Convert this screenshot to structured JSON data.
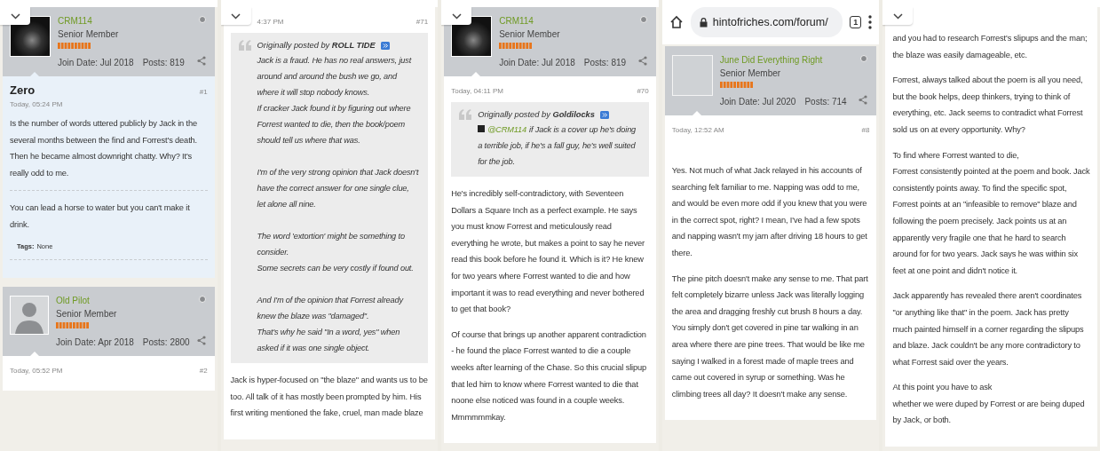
{
  "panels": [
    {
      "collapse_button": true,
      "posts": [
        {
          "profile": {
            "name": "CRM114",
            "title": "Senior Member",
            "join": "Join Date: Jul 2018",
            "posts": "Posts: 819",
            "avatar": {
              "kind": "photo"
            }
          },
          "body": {
            "highlighted": true,
            "title": "Zero",
            "date": "Today, 05:24 PM",
            "number": "#1",
            "blocks": [
              {
                "kind": "text",
                "text": "Is the number of words uttered publicly by Jack in the several months between the find and Forrest's death. Then he became almost downright chatty. Why? It's really odd to me."
              },
              {
                "kind": "signature",
                "text": "You can lead a horse to water but you can't make it drink."
              },
              {
                "kind": "tags",
                "label": "Tags:",
                "value": "None"
              }
            ]
          }
        },
        {
          "profile": {
            "name": "Old Pilot",
            "title": "Senior Member",
            "join": "Join Date: Apr 2018",
            "posts": "Posts: 2800",
            "avatar": {
              "kind": "silhouette"
            }
          },
          "body": {
            "highlighted": false,
            "date": "Today, 05:52 PM",
            "number": "#2"
          }
        }
      ]
    },
    {
      "collapse_button": true,
      "posts": [
        {
          "body": {
            "highlighted": false,
            "date": "4:37 PM",
            "number": "#71",
            "blocks": [
              {
                "kind": "quote",
                "prefix": "Originally posted by",
                "author": "ROLL TIDE",
                "text": "Jack is a fraud. He has no real answers, just around and around the bush we go, and where it will stop nobody knows.\nIf cracker Jack found it by figuring out where Forrest wanted to die, then the book/poem should tell us where that was.\n\nI'm of the very strong opinion that Jack doesn't have the correct answer for one single clue, let alone all nine.\n\nThe word 'extortion' might be something to consider.\nSome secrets can be very costly if found out.\n\nAnd I'm of the opinion that Forrest already knew the blaze was \"damaged\".\nThat's why he said \"In a word, yes\" when asked if it was one single object."
              },
              {
                "kind": "text",
                "text": "Jack is hyper-focused on \"the blaze\" and wants us to be too. All talk of it has mostly been prompted by him. His first writing mentioned the fake, cruel, man made blaze"
              }
            ]
          }
        }
      ]
    },
    {
      "collapse_button": true,
      "posts": [
        {
          "profile": {
            "name": "CRM114",
            "title": "Senior Member",
            "join": "Join Date: Jul 2018",
            "posts": "Posts: 819",
            "avatar": {
              "kind": "photo"
            }
          },
          "body": {
            "highlighted": false,
            "date": "Today, 04:11 PM",
            "number": "#70",
            "blocks": [
              {
                "kind": "quote",
                "prefix": "Originally posted by",
                "author": "Goldilocks",
                "mention": "@CRM114",
                "text": "if Jack is a cover up he's doing a terrible job, if he's a fall guy, he's well suited for the job."
              },
              {
                "kind": "text",
                "text": "He's incredibly self-contradictory, with Seventeen Dollars a Square Inch as a perfect example. He says you must know Forrest and meticulously read everything he wrote, but makes a point to say he never read this book before he found it. Which is it? He knew for two years where Forrest wanted to die and how important it was to read everything and never bothered to get that book?"
              },
              {
                "kind": "text",
                "text": "Of course that brings up another apparent contradiction - he found the place Forrest wanted to die a couple weeks after learning of the Chase. So this crucial slipup that led him to know where Forrest wanted to die that noone else noticed was found in a couple weeks. Mmmmmmkay."
              }
            ]
          }
        }
      ]
    },
    {
      "browser_bar": {
        "url": "hintofriches.com/forum/",
        "tab_count": "1"
      },
      "posts": [
        {
          "profile": {
            "name": "June Did Everything Right",
            "title": "Senior Member",
            "join": "Join Date: Jul 2020",
            "posts": "Posts: 714",
            "avatar": {
              "kind": "blank"
            }
          },
          "body": {
            "highlighted": false,
            "date": "Today, 12:52 AM",
            "number": "#8",
            "blocks": [
              {
                "kind": "text",
                "text": "Yes. Not much of what Jack relayed in his accounts of searching felt familiar to me. Napping was odd to me, and would be even more odd if you knew that you were in the correct spot, right? I mean, I've had a few spots and napping wasn't my jam after driving 18 hours to get there."
              },
              {
                "kind": "text",
                "text": "The pine pitch doesn't make any sense to me. That part felt completely bizarre unless Jack was literally logging the area and dragging freshly cut brush 8 hours a day. You simply don't get covered in pine tar walking in an area where there are pine trees. That would be like me saying I walked in a forest made of maple trees and came out covered in syrup or something. Was he climbing trees all day? It doesn't make any sense."
              }
            ]
          }
        }
      ]
    },
    {
      "collapse_button": true,
      "posts": [
        {
          "body": {
            "highlighted": false,
            "blocks": [
              {
                "kind": "text",
                "text": "and you had to research Forrest's slipups and the man; the blaze was easily damageable, etc."
              },
              {
                "kind": "text",
                "text": "Forrest, always talked about the poem is all you need, but the book helps, deep thinkers, trying to think of everything, etc. Jack seems to contradict what Forrest sold us on at every opportunity. Why?"
              },
              {
                "kind": "text",
                "text": "To find where Forrest wanted to die,\nForrest consistently pointed at the poem and book. Jack consistently points away. To find the specific spot, Forrest points at an \"infeasible to remove\" blaze and following the poem precisely. Jack points us at an apparently very fragile one that he hard to search around for for two years. Jack says he was within six feet at one point and didn't notice it."
              },
              {
                "kind": "text",
                "text": "Jack apparently has revealed there aren't coordinates \"or anything like that\" in the poem. Jack has pretty much painted himself in a corner regarding the slipups and blaze. Jack couldn't be any more contradictory to what Forrest said over the years."
              },
              {
                "kind": "text",
                "text": "At this point you have to ask\nwhether we were duped by Forrest or are being duped by Jack, or both."
              }
            ]
          }
        }
      ]
    }
  ]
}
